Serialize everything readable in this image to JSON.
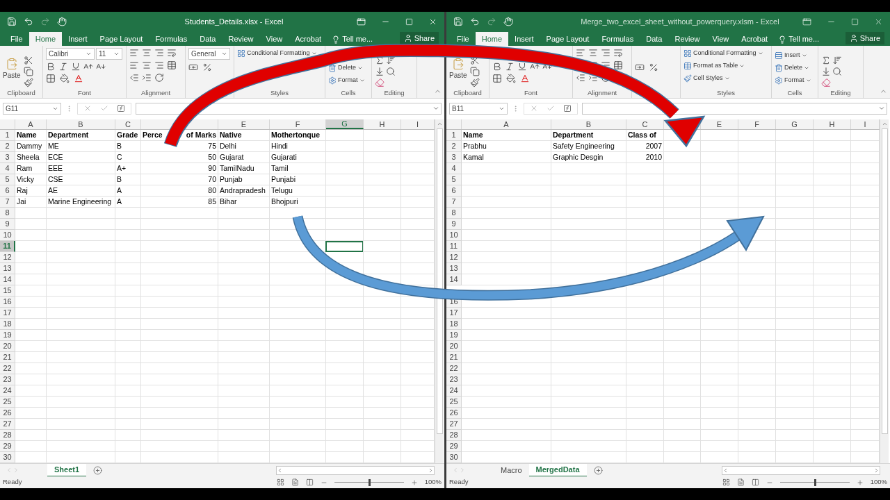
{
  "windows": [
    {
      "title": "Students_Details.xlsx - Excel",
      "active": true,
      "tabs": [
        {
          "label": "File",
          "selected": false
        },
        {
          "label": "Home",
          "selected": true
        },
        {
          "label": "Insert",
          "selected": false
        },
        {
          "label": "Page Layout",
          "selected": false
        },
        {
          "label": "Formulas",
          "selected": false
        },
        {
          "label": "Data",
          "selected": false
        },
        {
          "label": "Review",
          "selected": false
        },
        {
          "label": "View",
          "selected": false
        },
        {
          "label": "Acrobat",
          "selected": false
        }
      ],
      "tell_me": "Tell me...",
      "share": "Share",
      "ribbon": [
        {
          "kind": "clipboard",
          "label": "Clipboard",
          "paste": "Paste"
        },
        {
          "kind": "font",
          "label": "Font",
          "font": "Calibri",
          "size": "11"
        },
        {
          "kind": "alignment",
          "label": "Alignment"
        },
        {
          "kind": "number",
          "format": "General"
        },
        {
          "kind": "styles",
          "label": "Styles",
          "items": [
            {
              "kind": "conditional",
              "label": "Conditional Formatting"
            }
          ]
        },
        {
          "kind": "cells",
          "label": "Cells",
          "items": [
            {
              "kind": "delete",
              "label": "Delete"
            },
            {
              "kind": "format",
              "label": "Format"
            }
          ]
        },
        {
          "kind": "editing",
          "label": "Editing"
        }
      ],
      "name_box": "G11",
      "columns": [
        {
          "label": "A",
          "selected": false
        },
        {
          "label": "B",
          "selected": false
        },
        {
          "label": "C",
          "selected": false
        },
        {
          "numeric": true
        },
        {
          "label": "E",
          "selected": false
        },
        {
          "label": "F",
          "selected": false
        },
        {
          "label": "G",
          "selected": true
        },
        {
          "label": "H",
          "selected": false
        },
        {
          "label": "I",
          "selected": false
        }
      ],
      "rows": [
        {
          "number": "1",
          "header": true,
          "selected": false,
          "cells": [
            "Name",
            "Department",
            "Grade",
            [
              "Perce",
              "of Marks"
            ],
            "Native",
            "Mothertonque"
          ]
        },
        {
          "number": "2",
          "selected": false,
          "cells": [
            "Dammy",
            "ME",
            "B",
            "75",
            "Delhi",
            "Hindi"
          ]
        },
        {
          "number": "3",
          "selected": false,
          "cells": [
            "Sheela",
            "ECE",
            "C",
            "50",
            "Gujarat",
            "Gujarati"
          ]
        },
        {
          "number": "4",
          "selected": false,
          "cells": [
            "Ram",
            "EEE",
            "A+",
            "90",
            "TamilNadu",
            "Tamil"
          ]
        },
        {
          "number": "5",
          "selected": false,
          "cells": [
            "Vicky",
            "CSE",
            "B",
            "70",
            "Punjab",
            "Punjabi"
          ]
        },
        {
          "number": "6",
          "selected": false,
          "cells": [
            "Raj",
            "AE",
            "A",
            "80",
            "Andrapradesh",
            "Telugu"
          ]
        },
        {
          "number": "7",
          "selected": false,
          "cells": [
            "Jai",
            "Marine Engineering",
            "A",
            "85",
            "Bihar",
            "Bhojpuri"
          ]
        },
        {
          "number": "8",
          "selected": false
        },
        {
          "number": "9",
          "selected": false
        },
        {
          "number": "10",
          "selected": false
        },
        {
          "number": "11",
          "selected": true
        },
        {
          "number": "12",
          "selected": false
        },
        {
          "number": "13",
          "selected": false
        },
        {
          "number": "14",
          "selected": false
        },
        {
          "number": "15",
          "selected": false
        },
        {
          "number": "16",
          "selected": false
        },
        {
          "number": "17",
          "selected": false
        },
        {
          "number": "18",
          "selected": false
        },
        {
          "number": "19",
          "selected": false
        },
        {
          "number": "20",
          "selected": false
        },
        {
          "number": "21",
          "selected": false
        },
        {
          "number": "22",
          "selected": false
        },
        {
          "number": "23",
          "selected": false
        },
        {
          "number": "24",
          "selected": false
        },
        {
          "number": "25",
          "selected": false
        },
        {
          "number": "26",
          "selected": false
        },
        {
          "number": "27",
          "selected": false
        },
        {
          "number": "28",
          "selected": false
        },
        {
          "number": "29",
          "selected": false
        },
        {
          "number": "30",
          "selected": false
        }
      ],
      "sheets": [
        {
          "label": "Sheet1",
          "selected": true
        }
      ],
      "status": "Ready",
      "zoom": "100%",
      "zoom_slider": {
        "level": 0.5
      }
    },
    {
      "title": "Merge_two_excel_sheet_without_powerquery.xlsm - Excel",
      "active": false,
      "tabs": [
        {
          "label": "File",
          "selected": false
        },
        {
          "label": "Home",
          "selected": true
        },
        {
          "label": "Insert",
          "selected": false
        },
        {
          "label": "Page Layout",
          "selected": false
        },
        {
          "label": "Formulas",
          "selected": false
        },
        {
          "label": "Data",
          "selected": false
        },
        {
          "label": "Review",
          "selected": false
        },
        {
          "label": "View",
          "selected": false
        },
        {
          "label": "Acrobat",
          "selected": false
        }
      ],
      "tell_me": "Tell me...",
      "share": "Share",
      "ribbon": [
        {
          "kind": "clipboard",
          "label": "Clipboard",
          "paste": "Paste"
        },
        {
          "kind": "font",
          "label": "Font"
        },
        {
          "kind": "alignment",
          "label": "Alignment"
        },
        {
          "kind": "number"
        },
        {
          "kind": "styles",
          "label": "Styles",
          "items": [
            {
              "kind": "conditional",
              "label": "Conditional Formatting"
            },
            {
              "kind": "table",
              "label": "Format as Table"
            },
            {
              "kind": "cellstyles",
              "label": "Cell Styles"
            }
          ]
        },
        {
          "kind": "cells",
          "label": "Cells",
          "items": [
            {
              "kind": "insert",
              "label": "Insert"
            },
            {
              "kind": "delete",
              "label": "Delete"
            },
            {
              "kind": "format",
              "label": "Format"
            }
          ]
        },
        {
          "kind": "editing",
          "label": "Editing"
        }
      ],
      "name_box": "B11",
      "columns": [
        {
          "label": "A",
          "selected": false
        },
        {
          "label": "B",
          "selected": false
        },
        {
          "label": "C",
          "selected": false,
          "numeric": true
        },
        {},
        {
          "label": "E",
          "selected": false
        },
        {
          "label": "F",
          "selected": false
        },
        {
          "label": "G",
          "selected": false
        },
        {
          "label": "H",
          "selected": false
        },
        {
          "label": "I",
          "selected": false
        }
      ],
      "rows": [
        {
          "number": "1",
          "header": true,
          "selected": false,
          "cells": [
            "Name",
            "Department",
            "Class of"
          ]
        },
        {
          "number": "2",
          "selected": false,
          "cells": [
            "Prabhu",
            "Safety Engineering",
            "2007"
          ]
        },
        {
          "number": "3",
          "selected": false,
          "cells": [
            "Kamal",
            "Graphic Desgin",
            "2010"
          ]
        },
        {
          "number": "4",
          "selected": false
        },
        {
          "number": "5",
          "selected": false
        },
        {
          "number": "6",
          "selected": false
        },
        {
          "number": "7",
          "selected": false
        },
        {
          "number": "8",
          "selected": false
        },
        {
          "number": "9",
          "selected": false
        },
        {
          "number": "10",
          "selected": false
        },
        {
          "number": "11",
          "selected": false
        },
        {
          "number": "12",
          "selected": false
        },
        {
          "number": "13",
          "selected": false
        },
        {
          "number": "14",
          "selected": false
        },
        {},
        {
          "number": "16",
          "selected": false
        },
        {
          "number": "17",
          "selected": false
        },
        {
          "number": "18",
          "selected": false
        },
        {
          "number": "19",
          "selected": false
        },
        {
          "number": "20",
          "selected": false
        },
        {
          "number": "21",
          "selected": false
        },
        {
          "number": "22",
          "selected": false
        },
        {
          "number": "23",
          "selected": false
        },
        {
          "number": "24",
          "selected": false
        },
        {
          "number": "25",
          "selected": false
        },
        {
          "number": "26",
          "selected": false
        },
        {
          "number": "27",
          "selected": false
        },
        {
          "number": "28",
          "selected": false
        },
        {
          "number": "29",
          "selected": false
        },
        {
          "number": "30",
          "selected": false
        }
      ],
      "sheets": [
        {
          "label": "Macro",
          "selected": false
        },
        {
          "label": "MergedData",
          "selected": true
        }
      ],
      "status": "Ready",
      "zoom": "100%",
      "zoom_slider": {
        "level": 0.5
      }
    }
  ]
}
